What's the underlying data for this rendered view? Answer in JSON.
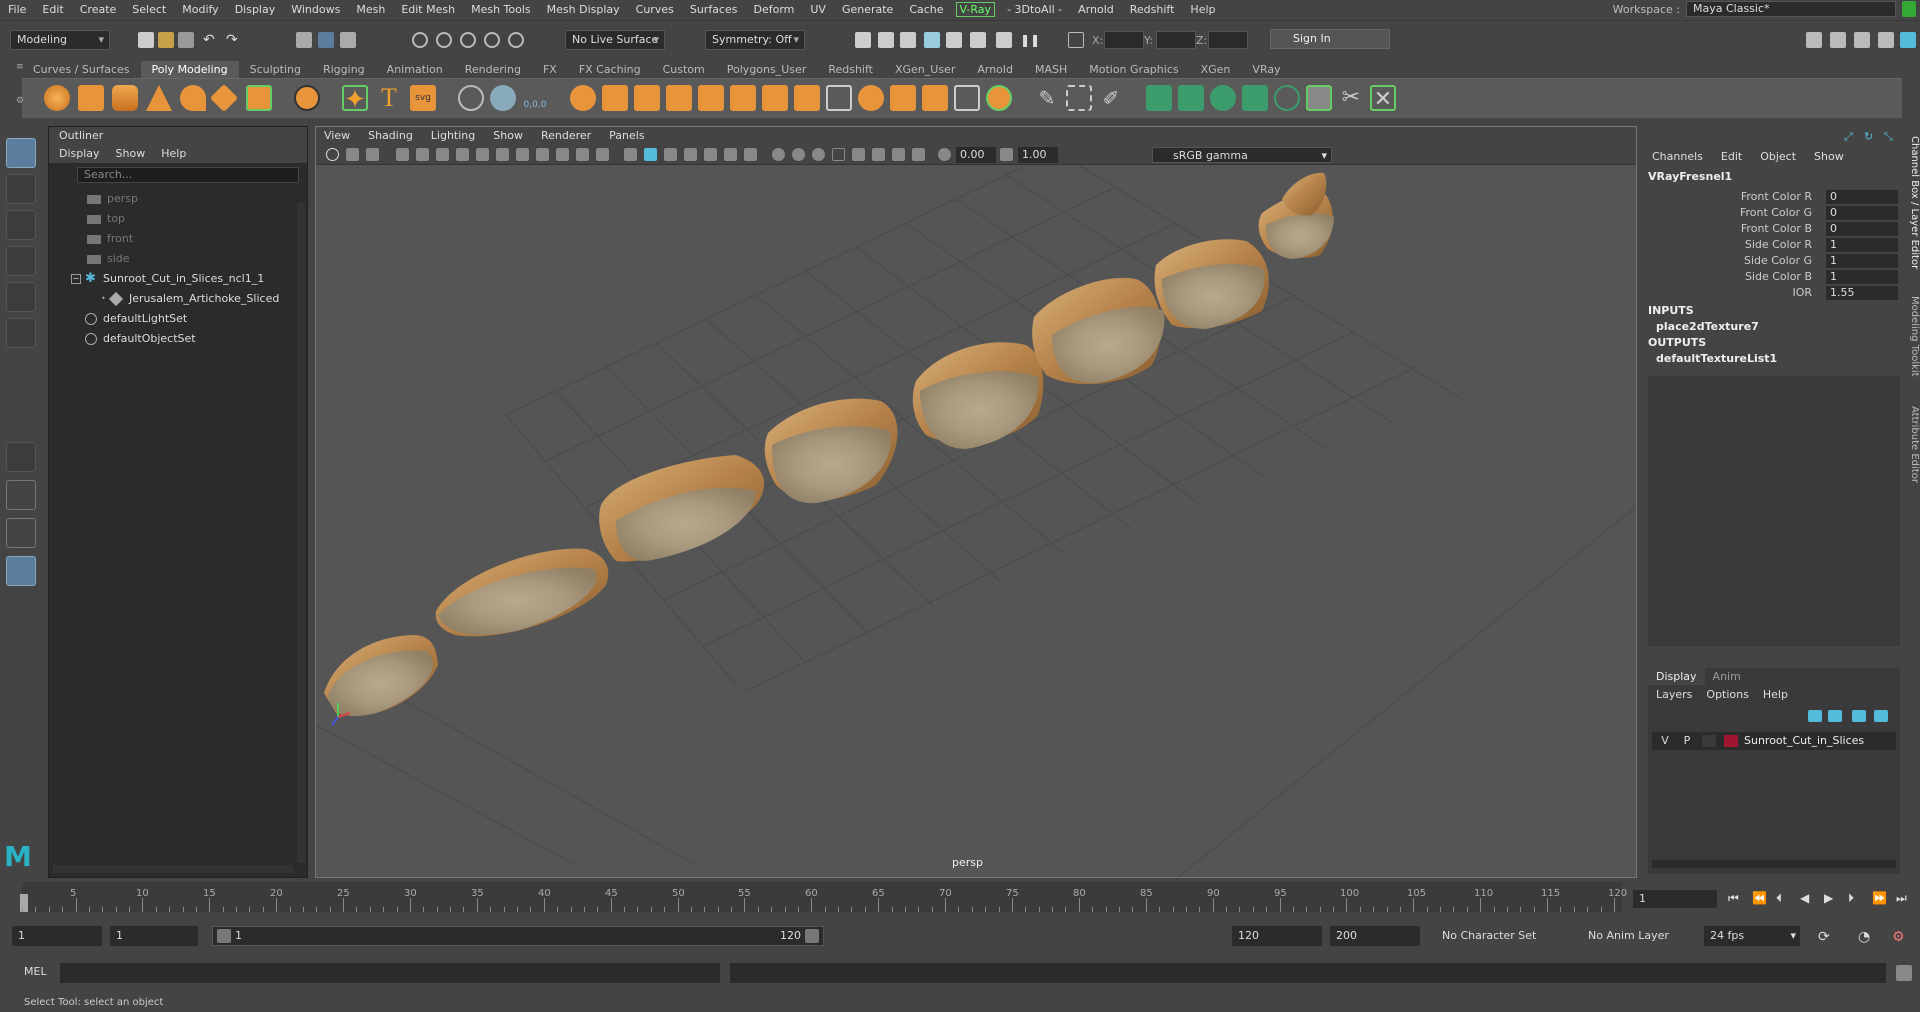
{
  "menubar": {
    "items": [
      "File",
      "Edit",
      "Create",
      "Select",
      "Modify",
      "Display",
      "Windows",
      "Mesh",
      "Edit Mesh",
      "Mesh Tools",
      "Mesh Display",
      "Curves",
      "Surfaces",
      "Deform",
      "UV",
      "Generate",
      "Cache"
    ],
    "vray": "V-Ray",
    "items2": [
      "- 3DtoAll -",
      "Arnold",
      "Redshift",
      "Help"
    ],
    "workspace_label": "Workspace :",
    "workspace_value": "Maya Classic*"
  },
  "statusline": {
    "mode": "Modeling",
    "live_surface": "No Live Surface",
    "symmetry": "Symmetry: Off",
    "x_label": "X:",
    "y_label": "Y:",
    "z_label": "Z:",
    "sign_in": "Sign In"
  },
  "shelf": {
    "tabs": [
      "Curves / Surfaces",
      "Poly Modeling",
      "Sculpting",
      "Rigging",
      "Animation",
      "Rendering",
      "FX",
      "FX Caching",
      "Custom",
      "Polygons_User",
      "Redshift",
      "XGen_User",
      "Arnold",
      "MASH",
      "Motion Graphics",
      "XGen",
      "VRay"
    ],
    "active_tab": 1
  },
  "outliner": {
    "title": "Outliner",
    "menu": [
      "Display",
      "Show",
      "Help"
    ],
    "search_placeholder": "Search...",
    "cameras": [
      "persp",
      "top",
      "front",
      "side"
    ],
    "group": "Sunroot_Cut_in_Slices_ncl1_1",
    "mesh": "Jerusalem_Artichoke_Sliced",
    "sets": [
      "defaultLightSet",
      "defaultObjectSet"
    ]
  },
  "viewport": {
    "menu": [
      "View",
      "Shading",
      "Lighting",
      "Show",
      "Renderer",
      "Panels"
    ],
    "exposure": "0.00",
    "gamma_value": "1.00",
    "color_space": "sRGB gamma",
    "camera_label": "persp"
  },
  "channel_box": {
    "menu": [
      "Channels",
      "Edit",
      "Object",
      "Show"
    ],
    "node": "VRayFresnel1",
    "attributes": [
      {
        "name": "Front Color R",
        "value": "0"
      },
      {
        "name": "Front Color G",
        "value": "0"
      },
      {
        "name": "Front Color B",
        "value": "0"
      },
      {
        "name": "Side Color R",
        "value": "1"
      },
      {
        "name": "Side Color G",
        "value": "1"
      },
      {
        "name": "Side Color B",
        "value": "1"
      },
      {
        "name": "IOR",
        "value": "1.55"
      }
    ],
    "inputs_label": "INPUTS",
    "input_node": "place2dTexture7",
    "outputs_label": "OUTPUTS",
    "output_node": "defaultTextureList1"
  },
  "side_tabs": [
    "Channel Box / Layer Editor",
    "Modeling Toolkit",
    "Attribute Editor"
  ],
  "layer_editor": {
    "tabs": [
      "Display",
      "Anim"
    ],
    "menu": [
      "Layers",
      "Options",
      "Help"
    ],
    "layer": {
      "v": "V",
      "p": "P",
      "name": "Sunroot_Cut_in_Slices",
      "color": "#a01530"
    }
  },
  "timeline": {
    "ticks": [
      "5",
      "10",
      "15",
      "20",
      "25",
      "30",
      "35",
      "40",
      "45",
      "50",
      "55",
      "60",
      "65",
      "70",
      "75",
      "80",
      "85",
      "90",
      "95",
      "100",
      "105",
      "110",
      "115",
      "120"
    ],
    "current_frame": "1",
    "start_marker": "1"
  },
  "range": {
    "start": "1",
    "playback_start": "1",
    "slider_start": "1",
    "slider_end": "120",
    "playback_end": "120",
    "end": "200",
    "character_set": "No Character Set",
    "anim_layer": "No Anim Layer",
    "fps": "24 fps"
  },
  "command_line": {
    "label": "MEL"
  },
  "help_line": "Select Tool: select an object"
}
